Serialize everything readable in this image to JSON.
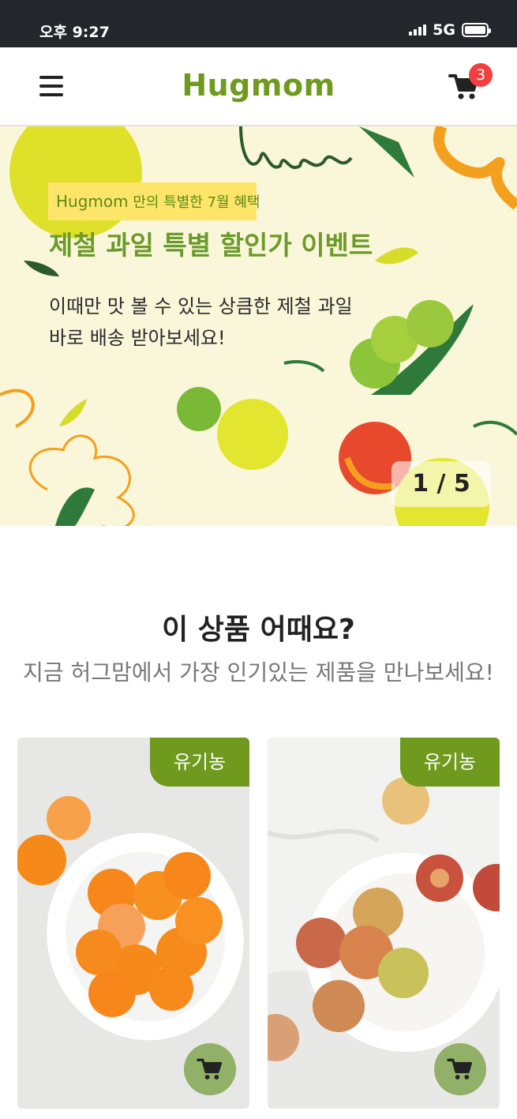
{
  "status_bar": {
    "time": "오후 9:27",
    "network": "5G"
  },
  "header": {
    "logo": "Hugmom",
    "cart_count": "3"
  },
  "banner": {
    "tag_brand": "Hugmom",
    "tag_text": "만의 특별한 7월 혜택",
    "title": "제철 과일 특별 할인가 이벤트",
    "description_line1": "이때만 맛 볼 수 있는 상큼한 제철 과일",
    "description_line2": "바로 배송 받아보세요!",
    "pager": "1 / 5"
  },
  "section": {
    "title": "이 상품 어때요?",
    "subtitle": "지금 허그맘에서 가장 인기있는 제품을 만나보세요!"
  },
  "products": [
    {
      "badge": "유기농",
      "image": "tangerines-on-plate"
    },
    {
      "badge": "유기농",
      "image": "plums-on-plate"
    }
  ],
  "colors": {
    "brand": "#6f9a1e",
    "badge_red": "#f23f3f",
    "banner_bg": "#faf6d9",
    "tag_yellow": "#fde56a"
  }
}
